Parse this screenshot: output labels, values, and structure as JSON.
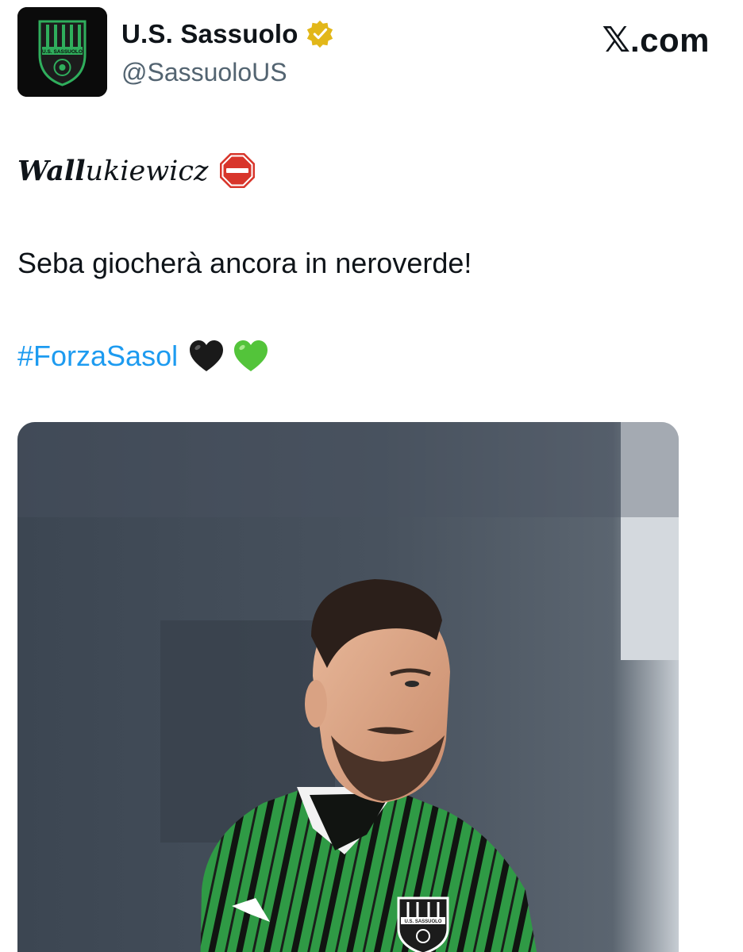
{
  "account": {
    "display_name": "U.S. Sassuolo",
    "handle": "@SassuoloUS",
    "avatar_icon": "sassuolo-crest-icon",
    "avatar_text": "U.S. SASSUOLO",
    "verified_icon": "gold-verified-badge-icon"
  },
  "brand": {
    "logo": "𝕏",
    "text": ".com"
  },
  "tweet": {
    "name_bold": "Wall",
    "name_rest": "ukiewicz",
    "line1_emoji": "stop-sign-icon",
    "line2": "Seba giocherà ancora in neroverde!",
    "hashtag": "#ForzaSasol",
    "hearts": [
      "black-heart-icon",
      "green-heart-icon"
    ]
  },
  "media": {
    "description_icon": "player-photo",
    "crest_text": "U.S. SASSUOLO"
  },
  "colors": {
    "sassuolo_green": "#1f9a4a",
    "hashtag_blue": "#1d9bf0",
    "handle_gray": "#536471",
    "verified_gold": "#e2b719"
  }
}
